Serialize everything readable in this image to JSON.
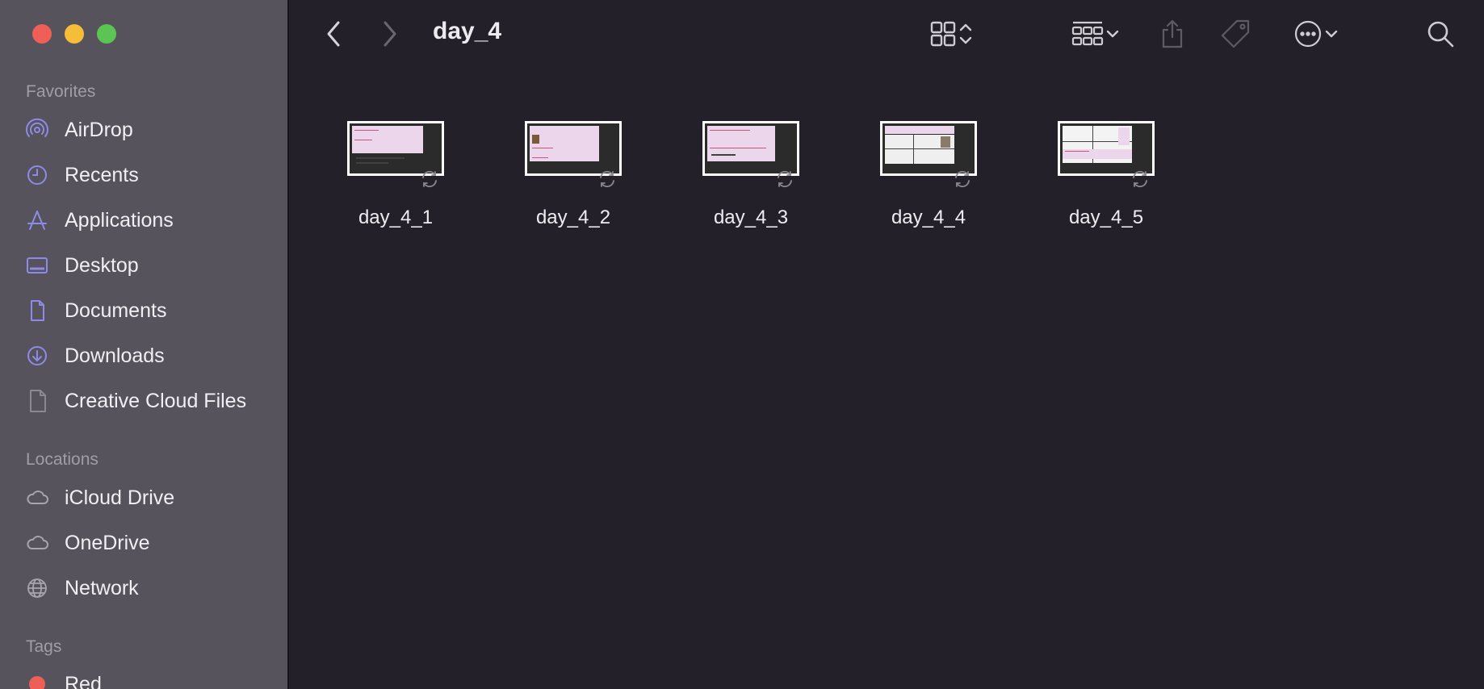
{
  "window": {
    "title": "day_4"
  },
  "sidebar": {
    "favorites_label": "Favorites",
    "favorites": [
      {
        "label": "AirDrop",
        "icon": "airdrop-icon"
      },
      {
        "label": "Recents",
        "icon": "clock-icon"
      },
      {
        "label": "Applications",
        "icon": "applications-icon"
      },
      {
        "label": "Desktop",
        "icon": "desktop-icon"
      },
      {
        "label": "Documents",
        "icon": "document-icon"
      },
      {
        "label": "Downloads",
        "icon": "download-icon"
      },
      {
        "label": "Creative Cloud Files",
        "icon": "file-icon"
      }
    ],
    "locations_label": "Locations",
    "locations": [
      {
        "label": "iCloud Drive",
        "icon": "cloud-icon"
      },
      {
        "label": "OneDrive",
        "icon": "cloud-icon"
      },
      {
        "label": "Network",
        "icon": "globe-icon"
      }
    ],
    "tags_label": "Tags",
    "tags": [
      {
        "label": "Red",
        "color": "#ee5f57"
      }
    ]
  },
  "toolbar": {
    "back": "chevron-left-icon",
    "forward": "chevron-right-icon",
    "view": "grid-view-icon",
    "group": "group-icon",
    "share": "share-icon",
    "tag": "tag-icon",
    "more": "ellipsis-circle-icon",
    "search": "search-icon"
  },
  "files": [
    {
      "name": "day_4_1"
    },
    {
      "name": "day_4_2"
    },
    {
      "name": "day_4_3"
    },
    {
      "name": "day_4_4"
    },
    {
      "name": "day_4_5"
    }
  ],
  "colors": {
    "sidebar_bg": "#57535c",
    "content_bg": "#242029",
    "icon_accent": "#8d8ae8",
    "close": "#ee5f57",
    "minimize": "#f6bd38",
    "zoom": "#5bc553"
  }
}
